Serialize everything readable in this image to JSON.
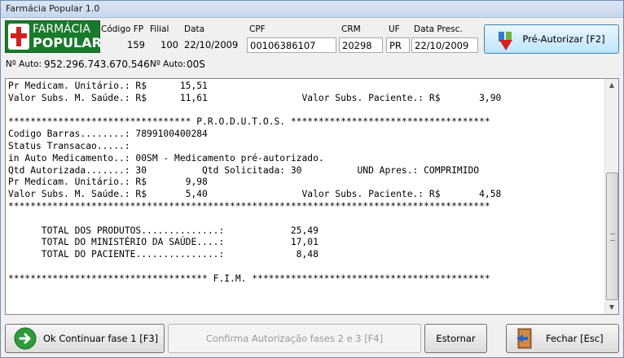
{
  "window": {
    "title": "Farmácia Popular 1.0"
  },
  "logo": {
    "line1": "FARMÁCIA",
    "line2": "POPULAR"
  },
  "header": {
    "codigo_fp": {
      "label": "Código FP",
      "value": "159"
    },
    "filial": {
      "label": "Filial",
      "value": "100"
    },
    "data": {
      "label": "Data",
      "value": "22/10/2009"
    },
    "cpf": {
      "label": "CPF",
      "value": "00106386107"
    },
    "crm": {
      "label": "CRM",
      "value": "20298"
    },
    "uf": {
      "label": "UF",
      "value": "PR"
    },
    "data_presc": {
      "label": "Data Presc.",
      "value": "22/10/2009"
    }
  },
  "auto": {
    "label1": "Nº Auto:",
    "value1": "952.296.743.670.546",
    "label2": "Nº Auto:",
    "value2": "00S"
  },
  "buttons": {
    "pre_autorizar": "Pré-Autorizar [F2]",
    "ok_continuar": "Ok Continuar fase 1  [F3]",
    "confirma": "Confirma Autorização fases 2 e 3  [F4]",
    "estornar": "Estornar",
    "fechar": "Fechar [Esc]"
  },
  "receipt": {
    "lines": [
      "Pr Medicam. Unitário.: R$      15,51",
      "Valor Subs. M. Saúde.: R$      11,61                 Valor Subs. Paciente.: R$       3,90",
      "",
      "********************************* P.R.O.D.U.T.O.S. ************************************",
      "Codigo Barras........: 7899100400284",
      "Status Transacao.....:",
      "in Auto Medicamento..: 00SM - Medicamento pré-autorizado.",
      "Qtd Autorizada.......: 30          Qtd Solicitada: 30          UND Apres.: COMPRIMIDO",
      "Pr Medicam. Unitário.: R$       9,98",
      "Valor Subs. M. Saúde.: R$       5,40                 Valor Subs. Paciente.: R$       4,58",
      "***************************************************************************************",
      "",
      "      TOTAL DOS PRODUTOS..............:            25,49",
      "      TOTAL DO MINISTÉRIO DA SAÚDE....:            17,01",
      "      TOTAL DO PACIENTE...............:             8,48",
      "",
      "************************************ F.I.M. *******************************************"
    ]
  }
}
